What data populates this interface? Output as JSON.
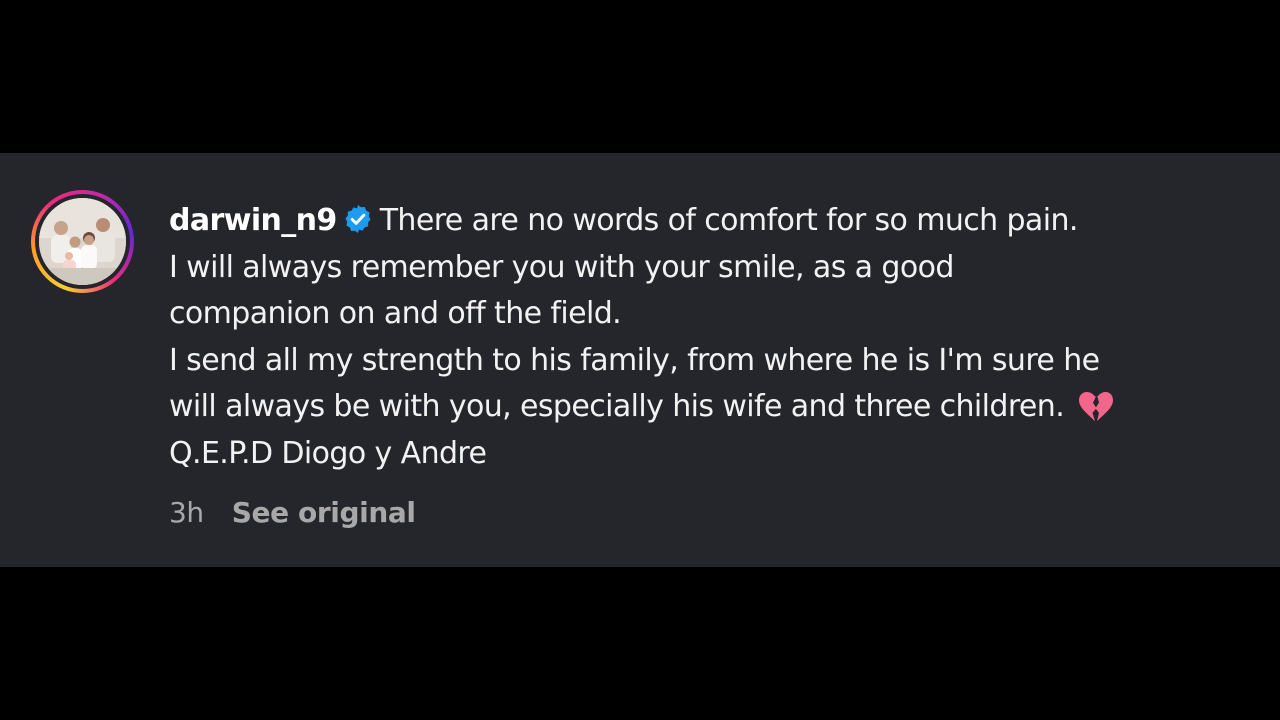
{
  "comment": {
    "avatar": {
      "icon": "profile-photo-icon",
      "ring_colors": [
        "#f9ce34",
        "#ee2a7b",
        "#6228d7"
      ]
    },
    "username": "darwin_n9",
    "verified_icon": "verified-badge-icon",
    "verified_color": "#1d9bf0",
    "lines": [
      "There are no words of comfort for so much pain.",
      "I will always remember you with your smile, as a good",
      "companion on and off the field.",
      "I send all my strength to his family, from where he is I'm sure he",
      "will always be with you, especially his wife and three children."
    ],
    "emoji_icon": "broken-heart-icon",
    "last_line": "Q.E.P.D Diogo y Andre",
    "timestamp": "3h",
    "see_original_label": "See original"
  },
  "colors": {
    "background": "#000000",
    "card": "#25262b",
    "text": "#f2f2f2",
    "muted": "#a8a8a8"
  }
}
